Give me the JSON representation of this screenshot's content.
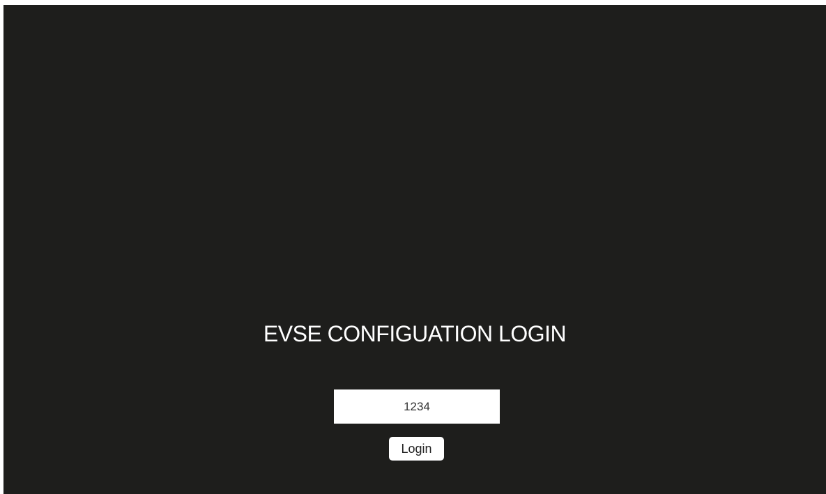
{
  "login": {
    "title": "EVSE CONFIGUATION LOGIN",
    "pin_value": "1234",
    "button_label": "Login"
  },
  "colors": {
    "background": "#1e1e1c",
    "text": "#ffffff",
    "field": "#ffffff"
  }
}
